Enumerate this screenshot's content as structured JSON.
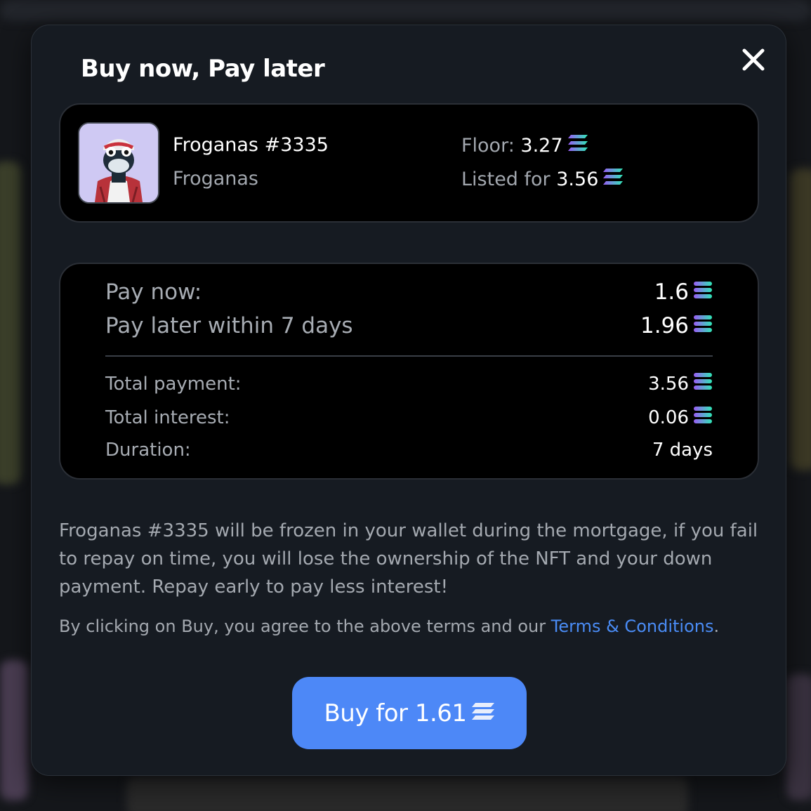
{
  "modal": {
    "title": "Buy now, Pay later",
    "close_icon": "close-icon"
  },
  "nft": {
    "name": "Froganas #3335",
    "collection": "Froganas",
    "floor_label": "Floor:",
    "floor_value": "3.27",
    "listed_label": "Listed for",
    "listed_value": "3.56"
  },
  "payment": {
    "pay_now_label": "Pay now:",
    "pay_now_value": "1.6",
    "pay_later_label": "Pay later within 7 days",
    "pay_later_value": "1.96",
    "total_payment_label": "Total payment:",
    "total_payment_value": "3.56",
    "total_interest_label": "Total interest:",
    "total_interest_value": "0.06",
    "duration_label": "Duration:",
    "duration_value": "7 days"
  },
  "notice": "Froganas #3335 will be frozen in your wallet during the mortgage, if you fail to repay on time, you will lose the ownership of the NFT and your down payment. Repay early to pay less interest!",
  "agreement": {
    "text": "By clicking on Buy, you agree to the above terms and our",
    "link_label": "Terms & Conditions",
    "suffix": "."
  },
  "buy_button": {
    "label": "Buy for 1.61"
  },
  "icons": {
    "currency": "solana-icon",
    "nft_image": "frog-avatar-image"
  },
  "colors": {
    "accent": "#4d88f7",
    "link": "#4a8cf5",
    "modal_bg": "#161b22",
    "card_bg": "#000000"
  }
}
